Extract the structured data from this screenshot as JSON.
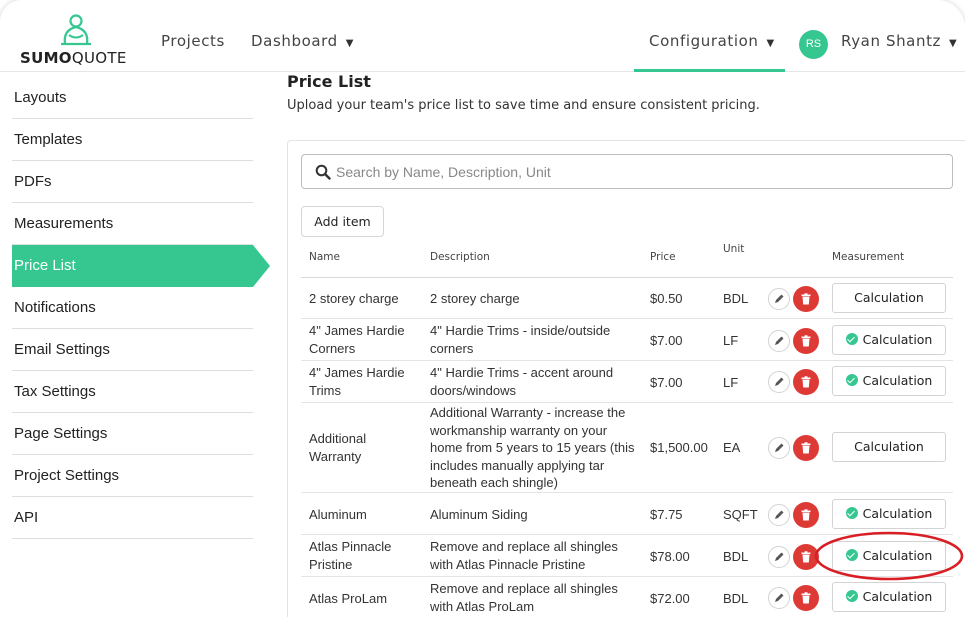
{
  "brand": {
    "logo_bold": "SUMO",
    "logo_regular": "QUOTE"
  },
  "nav": {
    "projects": "Projects",
    "dashboard": "Dashboard",
    "configuration": "Configuration",
    "user_initials": "RS",
    "user_name": "Ryan Shantz"
  },
  "sidebar": {
    "items": [
      {
        "label": "Layouts"
      },
      {
        "label": "Templates"
      },
      {
        "label": "PDFs"
      },
      {
        "label": "Measurements"
      },
      {
        "label": "Price List"
      },
      {
        "label": "Notifications"
      },
      {
        "label": "Email Settings"
      },
      {
        "label": "Tax Settings"
      },
      {
        "label": "Page Settings"
      },
      {
        "label": "Project Settings"
      },
      {
        "label": "API"
      }
    ],
    "active": "Price List"
  },
  "page": {
    "title": "Price List",
    "subtitle": "Upload your team's price list to save time and ensure consistent pricing."
  },
  "search": {
    "placeholder": "Search by Name, Description, Unit",
    "value": ""
  },
  "add_item_label": "Add item",
  "table": {
    "headers": {
      "name": "Name",
      "description": "Description",
      "price": "Price",
      "unit": "Unit",
      "measurement": "Measurement"
    },
    "rows": [
      {
        "name": "2 storey charge",
        "description": "2 storey charge",
        "price": "$0.50",
        "unit": "BDL",
        "measurement": "Calculation",
        "linked": false
      },
      {
        "name": "4\" James Hardie Corners",
        "description": "4\" Hardie Trims - inside/outside corners",
        "price": "$7.00",
        "unit": "LF",
        "measurement": "Calculation",
        "linked": true
      },
      {
        "name": "4\" James Hardie Trims",
        "description": "4\" Hardie Trims - accent around doors/windows",
        "price": "$7.00",
        "unit": "LF",
        "measurement": "Calculation",
        "linked": true
      },
      {
        "name": "Additional Warranty",
        "description": "Additional Warranty - increase the workmanship warranty on your home from 5 years to 15 years (this includes manually applying tar beneath each shingle)",
        "price": "$1,500.00",
        "unit": "EA",
        "measurement": "Calculation",
        "linked": false
      },
      {
        "name": "Aluminum",
        "description": "Aluminum Siding",
        "price": "$7.75",
        "unit": "SQFT",
        "measurement": "Calculation",
        "linked": true
      },
      {
        "name": "Atlas Pinnacle Pristine",
        "description": "Remove and replace all shingles with Atlas Pinnacle Pristine",
        "price": "$78.00",
        "unit": "BDL",
        "measurement": "Calculation",
        "linked": true
      },
      {
        "name": "Atlas ProLam",
        "description": "Remove and replace all shingles with Atlas ProLam",
        "price": "$72.00",
        "unit": "BDL",
        "measurement": "Calculation",
        "linked": true
      }
    ]
  },
  "icons": {
    "search": "search-icon",
    "edit": "pencil-icon",
    "delete": "trash-icon",
    "check": "check-circle-icon",
    "caret": "caret-down-icon"
  },
  "colors": {
    "accent": "#36c791",
    "danger": "#de3a35",
    "annotation": "#d91f26"
  }
}
